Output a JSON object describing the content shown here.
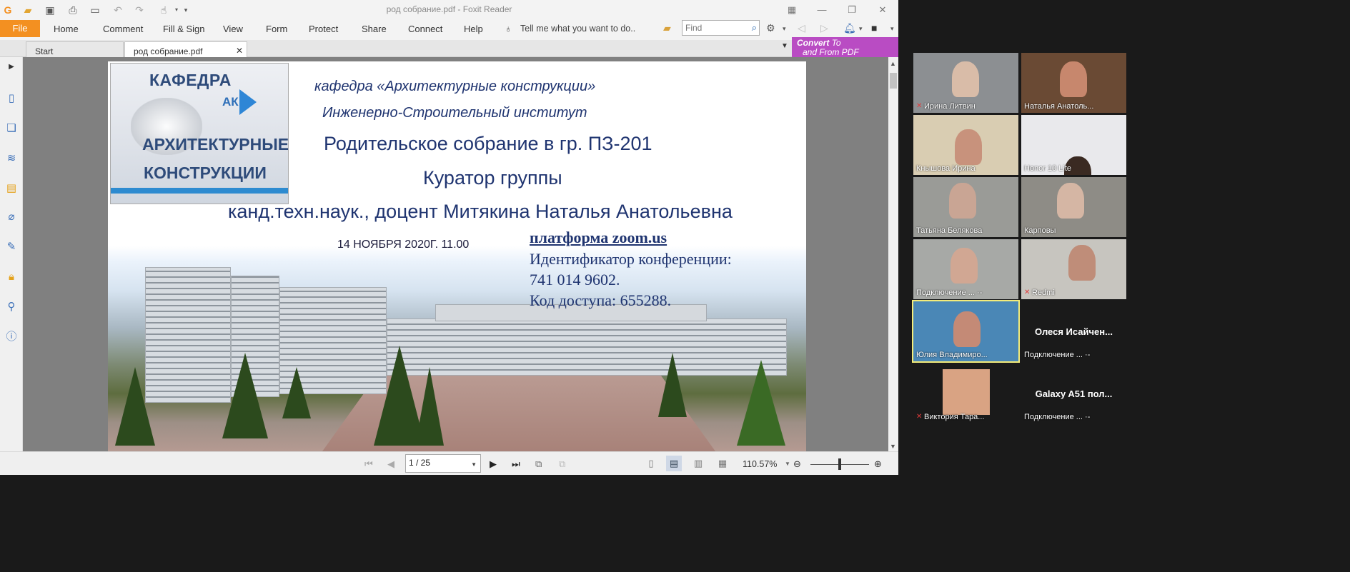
{
  "titlebar": {
    "title": "род собрание.pdf - Foxit Reader"
  },
  "ribbon": {
    "file": "File",
    "tabs": [
      "Home",
      "Comment",
      "Fill & Sign",
      "View",
      "Form",
      "Protect",
      "Share",
      "Connect",
      "Help"
    ],
    "tell_me": "Tell me what you want to do..",
    "find_placeholder": "Find"
  },
  "tabs": {
    "start": "Start",
    "doc": "род собрание.pdf"
  },
  "convert": {
    "line1": "Convert",
    "to": "To",
    "line2": "and From PDF"
  },
  "slide": {
    "logo_line1": "КАФЕДРА",
    "logo_ak": "АК",
    "logo_line2": "АРХИТЕКТУРНЫЕ",
    "logo_line3": "КОНСТРУКЦИИ",
    "dept": "кафедра «Архитектурные конструкции»",
    "institute": "Инженерно-Строительный институт",
    "meeting": "Родительское собрание в гр. ПЗ-201",
    "curator": "Куратор группы",
    "curator_name": "канд.техн.наук., доцент Митякина Наталья Анатольевна",
    "date": "14 НОЯБРЯ  2020Г.  11.00",
    "platform": "платформа zoom.us",
    "conf_id_label": "Идентификатор конференции:",
    "conf_id": " 741 014 9602.",
    "access_code": "Код доступа: 655288."
  },
  "status": {
    "page": "1 / 25",
    "zoom": "110.57%"
  },
  "participants": [
    {
      "name": "Ирина Литвин",
      "muted": true,
      "bg": "#8c8f92"
    },
    {
      "name": "Наталья Анатоль...",
      "muted": false,
      "bg": "#6a4a34"
    },
    {
      "name": "Кнышова Ирина",
      "muted": false,
      "bg": "#d9cdb2"
    },
    {
      "name": "Honor 10 Lite",
      "muted": false,
      "bg": "#e9e9ec"
    },
    {
      "name": "Татьяна Белякова",
      "muted": false,
      "bg": "#9a9b97"
    },
    {
      "name": "Карповы",
      "muted": false,
      "bg": "#8e8c86"
    },
    {
      "name": "Подключение ... ·-",
      "muted": false,
      "bg": "#a7a9a6"
    },
    {
      "name": "Redmi",
      "muted": true,
      "bg": "#c7c5bf"
    },
    {
      "name": "Юлия Владимиро...",
      "muted": false,
      "bg": "#4a87b6"
    },
    {
      "name": "Подключение ... ·-",
      "muted": false,
      "bg": "#1a1a1a",
      "big": "Олеся  Исайчен..."
    },
    {
      "name": "Виктория Тара...",
      "muted": true,
      "bg": "#1a1a1a"
    },
    {
      "name": "Подключение ... ·-",
      "muted": false,
      "bg": "#1a1a1a",
      "big": "Galaxy A51 пол..."
    }
  ]
}
